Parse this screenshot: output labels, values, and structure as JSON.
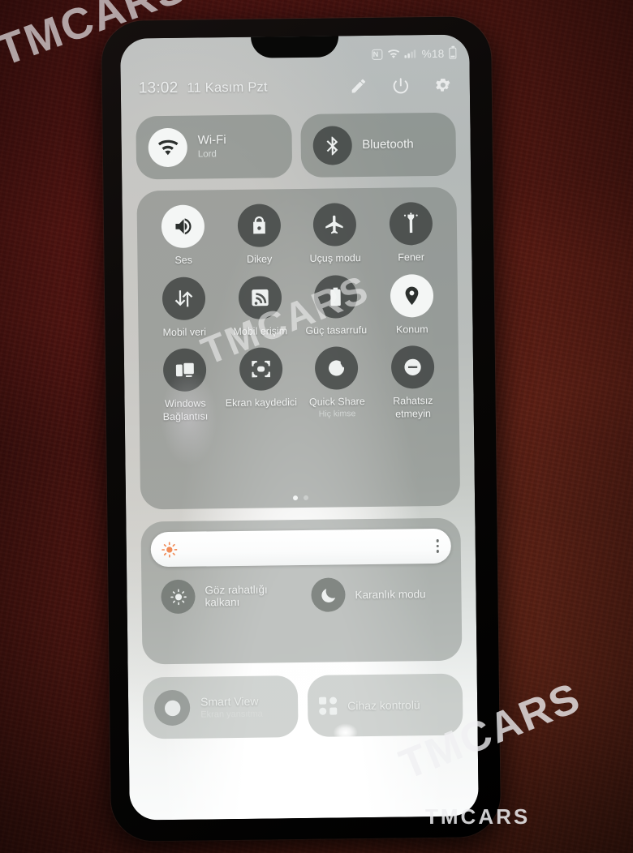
{
  "watermark": {
    "brand": "TMCARS"
  },
  "statusbar": {
    "icons": [
      "nfc-icon",
      "wifi-icon",
      "signal-icon"
    ],
    "nfc_glyph": "N",
    "battery_percent": "%18"
  },
  "header": {
    "time": "13:02",
    "date": "11 Kasım Pzt",
    "actions": [
      {
        "name": "edit-icon",
        "label": "Düzenle"
      },
      {
        "name": "power-icon",
        "label": "Güç"
      },
      {
        "name": "settings-gear-icon",
        "label": "Ayarlar"
      }
    ]
  },
  "top_tiles": [
    {
      "label": "Wi-Fi",
      "sublabel": "Lord",
      "icon": "wifi-icon",
      "active": true
    },
    {
      "label": "Bluetooth",
      "sublabel": "",
      "icon": "bluetooth-icon",
      "active": false
    }
  ],
  "quick_tiles": [
    {
      "label": "Ses",
      "sublabel": "",
      "icon": "volume-icon",
      "active": true
    },
    {
      "label": "Dikey",
      "sublabel": "",
      "icon": "rotation-lock-icon",
      "active": false
    },
    {
      "label": "Uçuş modu",
      "sublabel": "",
      "icon": "airplane-icon",
      "active": false
    },
    {
      "label": "Fener",
      "sublabel": "",
      "icon": "flashlight-icon",
      "active": false
    },
    {
      "label": "Mobil veri",
      "sublabel": "",
      "icon": "mobile-data-icon",
      "active": false
    },
    {
      "label": "Mobil erişim",
      "sublabel": "",
      "icon": "hotspot-icon",
      "active": false
    },
    {
      "label": "Güç tasarrufu",
      "sublabel": "",
      "icon": "power-saving-icon",
      "active": false
    },
    {
      "label": "Konum",
      "sublabel": "",
      "icon": "location-pin-icon",
      "active": true
    },
    {
      "label": "Windows Bağlantısı",
      "sublabel": "",
      "icon": "link-to-windows-icon",
      "active": false
    },
    {
      "label": "Ekran kaydedici",
      "sublabel": "",
      "icon": "screen-recorder-icon",
      "active": false
    },
    {
      "label": "Quick Share",
      "sublabel": "Hiç kimse",
      "icon": "quick-share-icon",
      "active": false
    },
    {
      "label": "Rahatsız etmeyin",
      "sublabel": "",
      "icon": "do-not-disturb-icon",
      "active": false
    }
  ],
  "pager": {
    "pages": 2,
    "current": 1
  },
  "brightness": {
    "value": 100,
    "sun_icon": "brightness-sun-icon",
    "menu_icon": "kebab-menu-icon",
    "toggles": [
      {
        "label": "Göz rahatlığı kalkanı",
        "icon": "eye-comfort-shield-icon"
      },
      {
        "label": "Karanlık modu",
        "icon": "dark-mode-moon-icon"
      }
    ]
  },
  "bottom_cards": [
    {
      "label": "Smart View",
      "sublabel": "Ekran yansıtma",
      "icon": "smart-view-icon"
    },
    {
      "label": "Cihaz kontrolü",
      "sublabel": "",
      "icon": "device-control-grid-icon"
    }
  ],
  "colors": {
    "accent_sun": "#f08b57",
    "panel": "#767c78",
    "active_tile": "#f4f6f5",
    "inactive_tile": "#3a3e3c"
  }
}
